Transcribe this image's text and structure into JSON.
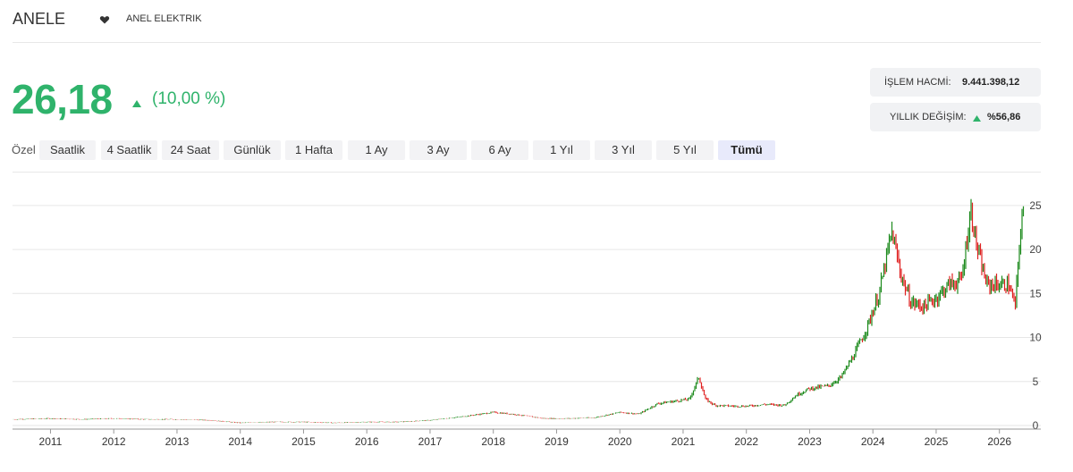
{
  "header": {
    "ticker": "ANELE",
    "favorite_icon": "heart-icon",
    "company_name": "ANEL ELEKTRIK"
  },
  "quote": {
    "price": "26,18",
    "change_icon": "up-triangle-icon",
    "change_pct": "(10,00 %)"
  },
  "stats": {
    "volume_label": "İŞLEM HACMİ:",
    "volume_value": "9.441.398,12",
    "yearly_label": "YILLIK DEĞİŞİM:",
    "yearly_value": "%56,86"
  },
  "ranges": {
    "custom_label": "Özel",
    "buttons": [
      "Saatlik",
      "4 Saatlik",
      "24 Saat",
      "Günlük",
      "1 Hafta",
      "1 Ay",
      "3 Ay",
      "6 Ay",
      "1 Yıl",
      "3 Yıl",
      "5 Yıl",
      "Tümü"
    ],
    "active": "Tümü"
  },
  "colors": {
    "accent_green": "#2fb36b",
    "candle_up": "#1d8a1d",
    "candle_down": "#e02020",
    "grid": "#e6e6e6"
  },
  "chart_data": {
    "type": "line",
    "style": "candlestick",
    "grid": true,
    "y_axis_side": "right",
    "xlim": [
      2010.4,
      2026.4
    ],
    "ylim": [
      0,
      26
    ],
    "y_ticks": [
      "0",
      "5",
      "10",
      "15",
      "20",
      "25"
    ],
    "x_ticks": [
      "2011",
      "2012",
      "2013",
      "2014",
      "2015",
      "2016",
      "2017",
      "2018",
      "2019",
      "2020",
      "2021",
      "2022",
      "2023",
      "2024",
      "2025",
      "2026"
    ],
    "series": [
      {
        "x": [
          2010.4,
          2011.0,
          2011.5,
          2012.0,
          2012.5,
          2013.0,
          2013.5,
          2014.0,
          2014.5,
          2015.0,
          2015.5,
          2016.0,
          2016.5,
          2017.0,
          2017.5,
          2018.0,
          2018.3,
          2018.8,
          2019.2,
          2019.6,
          2020.0,
          2020.3,
          2020.6,
          2020.9,
          2021.1,
          2021.25,
          2021.35,
          2021.5,
          2021.8,
          2022.0,
          2022.3,
          2022.6,
          2022.8,
          2023.0,
          2023.3,
          2023.5,
          2023.7,
          2023.9,
          2024.1,
          2024.3,
          2024.45,
          2024.6,
          2024.8,
          2025.0,
          2025.2,
          2025.4,
          2025.55,
          2025.65,
          2025.8,
          2026.0,
          2026.15,
          2026.25,
          2026.35
        ],
        "y": [
          0.7,
          0.8,
          0.7,
          0.8,
          0.7,
          0.7,
          0.6,
          0.3,
          0.4,
          0.4,
          0.3,
          0.4,
          0.4,
          0.6,
          1.0,
          1.5,
          1.3,
          0.8,
          0.8,
          0.9,
          1.5,
          1.3,
          2.5,
          2.8,
          3.0,
          5.5,
          3.0,
          2.3,
          2.2,
          2.2,
          2.4,
          2.3,
          3.5,
          4.2,
          4.5,
          5.5,
          8.0,
          11.0,
          15.0,
          22.0,
          17.0,
          14.0,
          13.5,
          14.5,
          16.0,
          16.5,
          24.5,
          20.0,
          16.0,
          16.0,
          16.0,
          13.5,
          23.8
        ]
      }
    ]
  }
}
